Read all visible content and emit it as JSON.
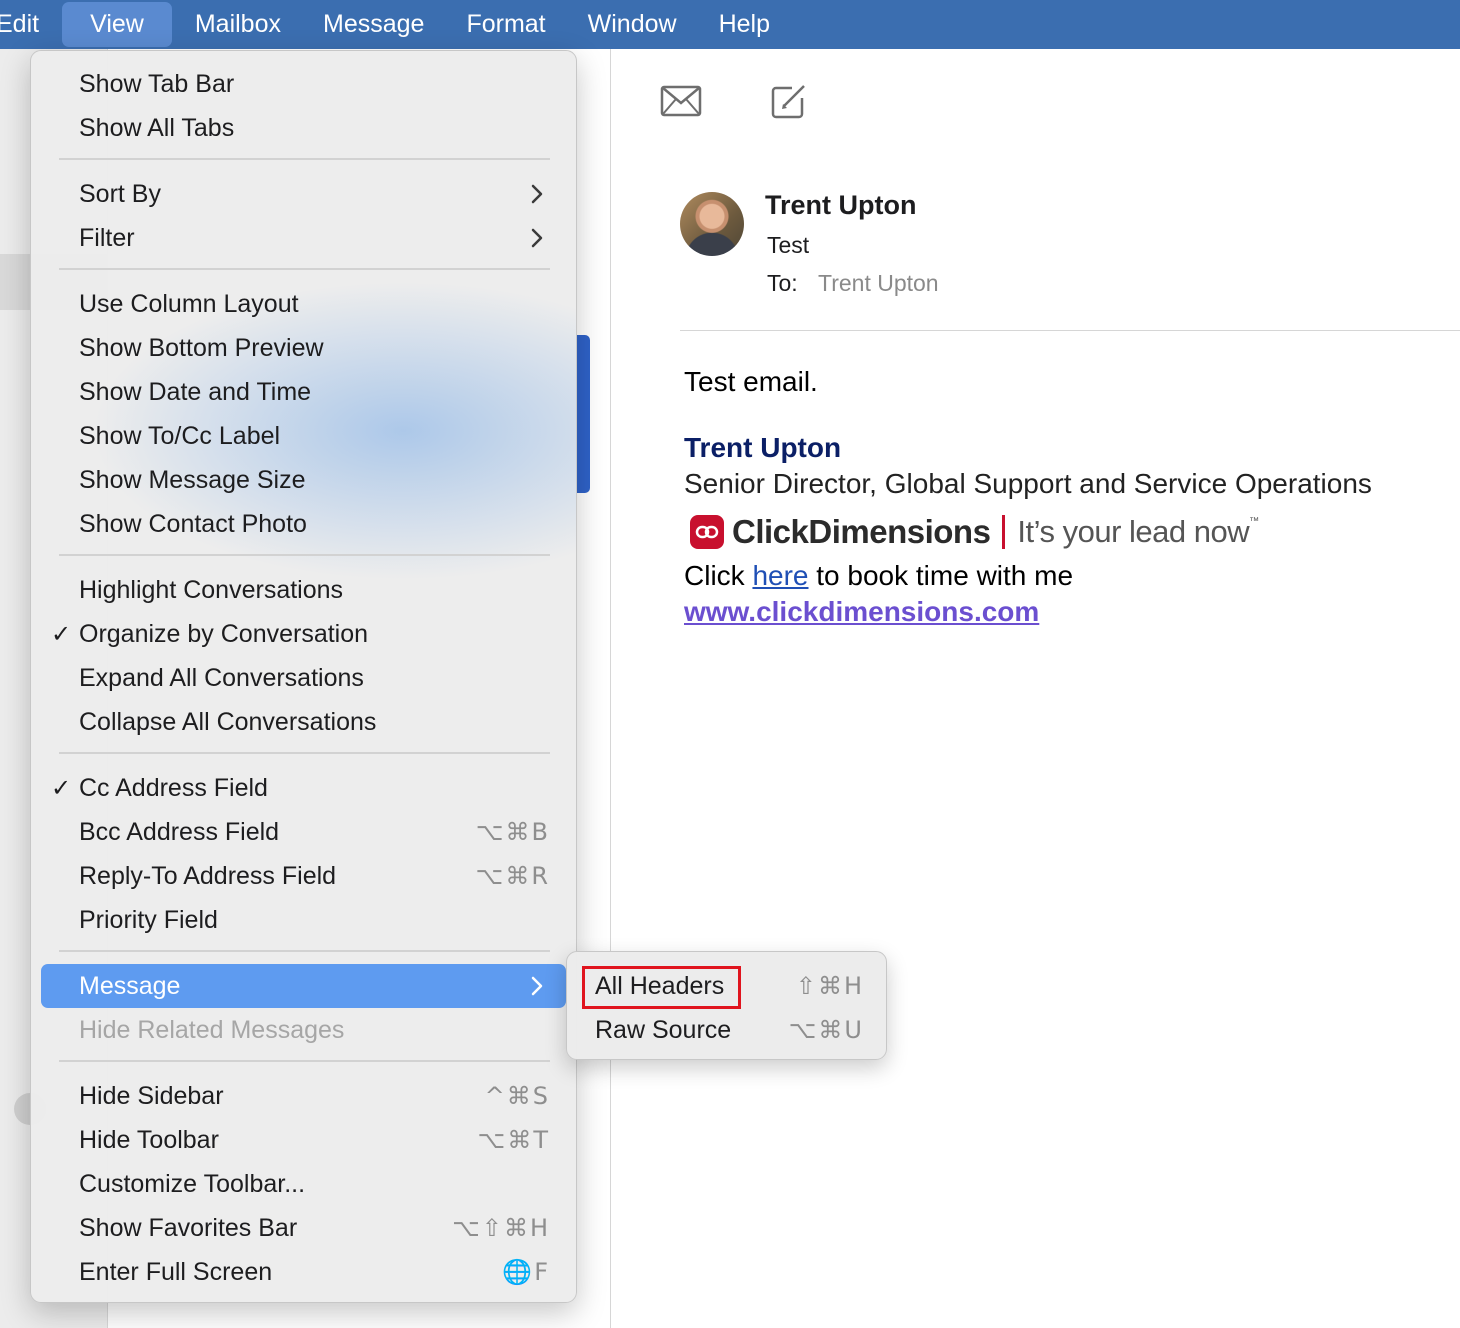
{
  "menubar": {
    "items": [
      "Edit",
      "View",
      "Mailbox",
      "Message",
      "Format",
      "Window",
      "Help"
    ],
    "active": "View"
  },
  "view_menu": {
    "items": [
      {
        "label": "Show Tab Bar"
      },
      {
        "label": "Show All Tabs"
      },
      {
        "label": "Sort By",
        "submenu": true
      },
      {
        "label": "Filter",
        "submenu": true
      },
      {
        "label": "Use Column Layout"
      },
      {
        "label": "Show Bottom Preview"
      },
      {
        "label": "Show Date and Time"
      },
      {
        "label": "Show To/Cc Label"
      },
      {
        "label": "Show Message Size"
      },
      {
        "label": "Show Contact Photo"
      },
      {
        "label": "Highlight Conversations"
      },
      {
        "label": "Organize by Conversation",
        "checked": true
      },
      {
        "label": "Expand All Conversations"
      },
      {
        "label": "Collapse All Conversations"
      },
      {
        "label": "Cc Address Field",
        "checked": true
      },
      {
        "label": "Bcc Address Field",
        "shortcut": "⌥⌘B"
      },
      {
        "label": "Reply-To Address Field",
        "shortcut": "⌥⌘R"
      },
      {
        "label": "Priority Field"
      },
      {
        "label": "Message",
        "submenu": true,
        "highlighted": true
      },
      {
        "label": "Hide Related Messages",
        "disabled": true
      },
      {
        "label": "Hide Sidebar",
        "shortcut": "^⌘S"
      },
      {
        "label": "Hide Toolbar",
        "shortcut": "⌥⌘T"
      },
      {
        "label": "Customize Toolbar..."
      },
      {
        "label": "Show Favorites Bar",
        "shortcut": "⌥⇧⌘H"
      },
      {
        "label": "Enter Full Screen",
        "shortcut": "🌐F"
      }
    ],
    "checkmark": "✓"
  },
  "message_submenu": {
    "items": [
      {
        "label": "All Headers",
        "shortcut": "⇧⌘H",
        "outlined": true,
        "outline_color": "#e0141e"
      },
      {
        "label": "Raw Source",
        "shortcut": "⌥⌘U"
      }
    ]
  },
  "email": {
    "sender": "Trent Upton",
    "subject": "Test",
    "to_label": "To:",
    "to_value": "Trent Upton",
    "body": "Test email.",
    "signature": {
      "name": "Trent Upton",
      "title": "Senior Director, Global Support and Service Operations",
      "logo_word": "ClickDimensions",
      "logo_tagline": "It’s your lead now",
      "logo_tm": "™",
      "click_prefix": "Click ",
      "click_link": "here",
      "click_suffix": " to book time with me",
      "website": "www.clickdimensions.com"
    }
  },
  "colors": {
    "menubar": "#3b6eb0",
    "highlight": "#5e9bf0",
    "outline": "#e0141e",
    "brand": "#c8102e"
  },
  "icons": [
    "envelope-icon",
    "compose-icon",
    "chevron-right-icon"
  ]
}
